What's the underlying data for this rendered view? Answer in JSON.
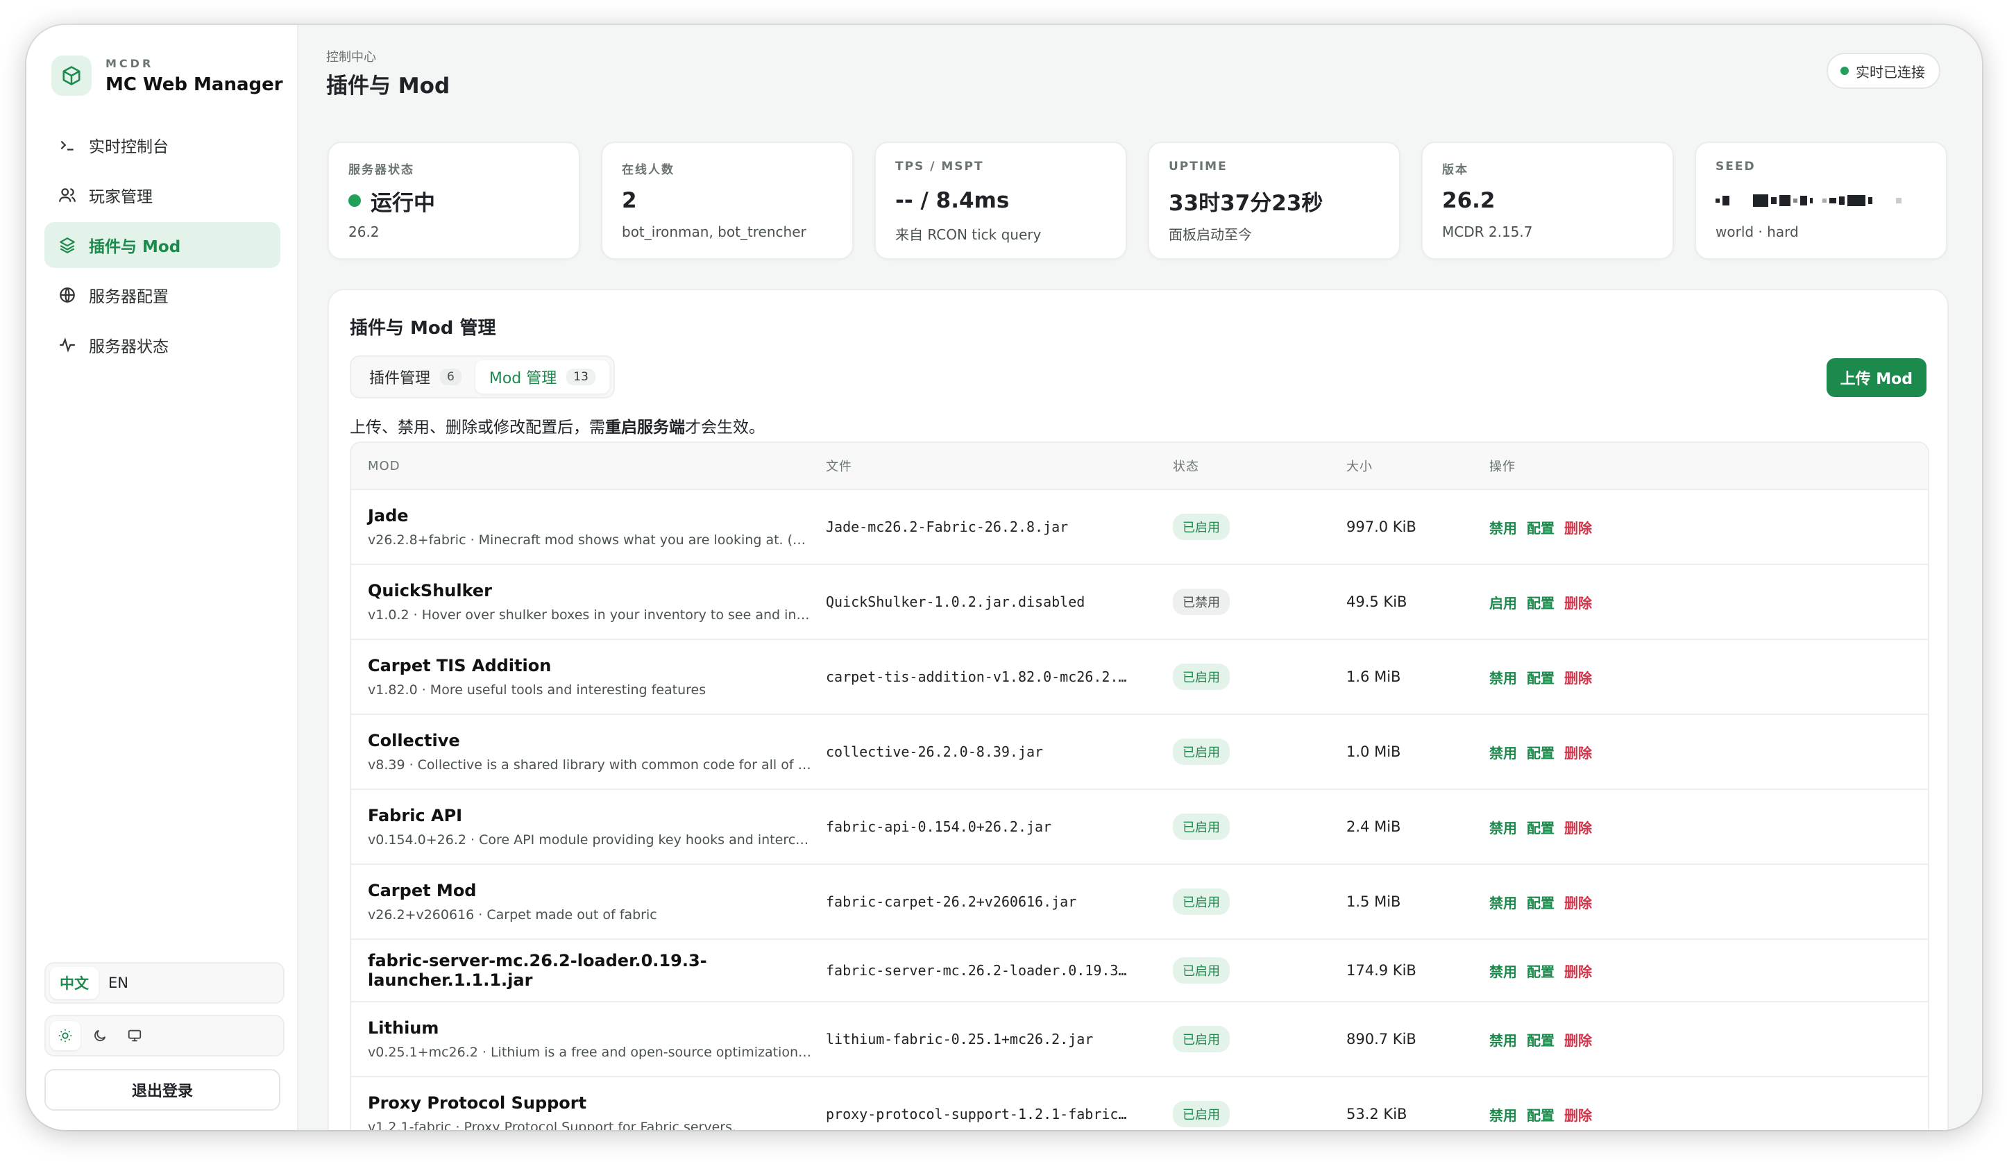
{
  "brand": {
    "sub": "MCDR",
    "title": "MC Web Manager"
  },
  "nav": [
    {
      "label": "实时控制台",
      "icon": "terminal-icon"
    },
    {
      "label": "玩家管理",
      "icon": "users-icon"
    },
    {
      "label": "插件与 Mod",
      "icon": "layers-icon",
      "active": true
    },
    {
      "label": "服务器配置",
      "icon": "globe-icon"
    },
    {
      "label": "服务器状态",
      "icon": "activity-icon"
    }
  ],
  "lang": {
    "zh": "中文",
    "en": "EN"
  },
  "logout": "退出登录",
  "header": {
    "crumb": "控制中心",
    "title": "插件与 Mod",
    "connection": "实时已连接"
  },
  "stats": [
    {
      "label": "服务器状态",
      "value": "运行中",
      "sub": "26.2"
    },
    {
      "label": "在线人数",
      "value": "2",
      "sub": "bot_ironman, bot_trencher"
    },
    {
      "label": "TPS / MSPT",
      "value": "-- / 8.4ms",
      "sub": "来自 RCON tick query"
    },
    {
      "label": "UPTIME",
      "value": "33时37分23秒",
      "sub": "面板启动至今"
    },
    {
      "label": "版本",
      "value": "26.2",
      "sub": "MCDR 2.15.7"
    },
    {
      "label": "SEED",
      "value": "",
      "sub": "world · hard"
    }
  ],
  "panel": {
    "title": "插件与 Mod 管理",
    "tabs": [
      {
        "label": "插件管理",
        "count": "6"
      },
      {
        "label": "Mod 管理",
        "count": "13"
      }
    ],
    "upload": "上传 Mod",
    "notice_pre": "上传、禁用、删除或修改配置后，需",
    "notice_bold": "重启服务端",
    "notice_post": "才会生效。",
    "columns": {
      "mod": "MOD",
      "file": "文件",
      "state": "状态",
      "size": "大小",
      "actions": "操作"
    },
    "actions": {
      "disable": "禁用",
      "enable": "启用",
      "config": "配置",
      "delete": "删除"
    }
  },
  "mods": [
    {
      "name": "Jade",
      "desc": "v26.2.8+fabric · Minecraft mod shows what you are looking at. (H…",
      "file": "Jade-mc26.2-Fabric-26.2.8.jar",
      "state": "已启用",
      "enabled": true,
      "size": "997.0 KiB"
    },
    {
      "name": "QuickShulker",
      "desc": "v1.0.2 · Hover over shulker boxes in your inventory to see and inter…",
      "file": "QuickShulker-1.0.2.jar.disabled",
      "state": "已禁用",
      "enabled": false,
      "size": "49.5 KiB"
    },
    {
      "name": "Carpet TIS Addition",
      "desc": "v1.82.0 · More useful tools and interesting features",
      "file": "carpet-tis-addition-v1.82.0-mc26.2.…",
      "state": "已启用",
      "enabled": true,
      "size": "1.6 MiB"
    },
    {
      "name": "Collective",
      "desc": "v8.39 · Collective is a shared library with common code for all of S…",
      "file": "collective-26.2.0-8.39.jar",
      "state": "已启用",
      "enabled": true,
      "size": "1.0 MiB"
    },
    {
      "name": "Fabric API",
      "desc": "v0.154.0+26.2 · Core API module providing key hooks and interco…",
      "file": "fabric-api-0.154.0+26.2.jar",
      "state": "已启用",
      "enabled": true,
      "size": "2.4 MiB"
    },
    {
      "name": "Carpet Mod",
      "desc": "v26.2+v260616 · Carpet made out of fabric",
      "file": "fabric-carpet-26.2+v260616.jar",
      "state": "已启用",
      "enabled": true,
      "size": "1.5 MiB"
    },
    {
      "name": "fabric-server-mc.26.2-loader.0.19.3-launcher.1.1.1.jar",
      "desc": "",
      "file": "fabric-server-mc.26.2-loader.0.19.3…",
      "state": "已启用",
      "enabled": true,
      "size": "174.9 KiB"
    },
    {
      "name": "Lithium",
      "desc": "v0.25.1+mc26.2 · Lithium is a free and open-source optimization …",
      "file": "lithium-fabric-0.25.1+mc26.2.jar",
      "state": "已启用",
      "enabled": true,
      "size": "890.7 KiB"
    },
    {
      "name": "Proxy Protocol Support",
      "desc": "v1.2.1-fabric · Proxy Protocol Support for Fabric servers.",
      "file": "proxy-protocol-support-1.2.1-fabric…",
      "state": "已启用",
      "enabled": true,
      "size": "53.2 KiB"
    }
  ]
}
